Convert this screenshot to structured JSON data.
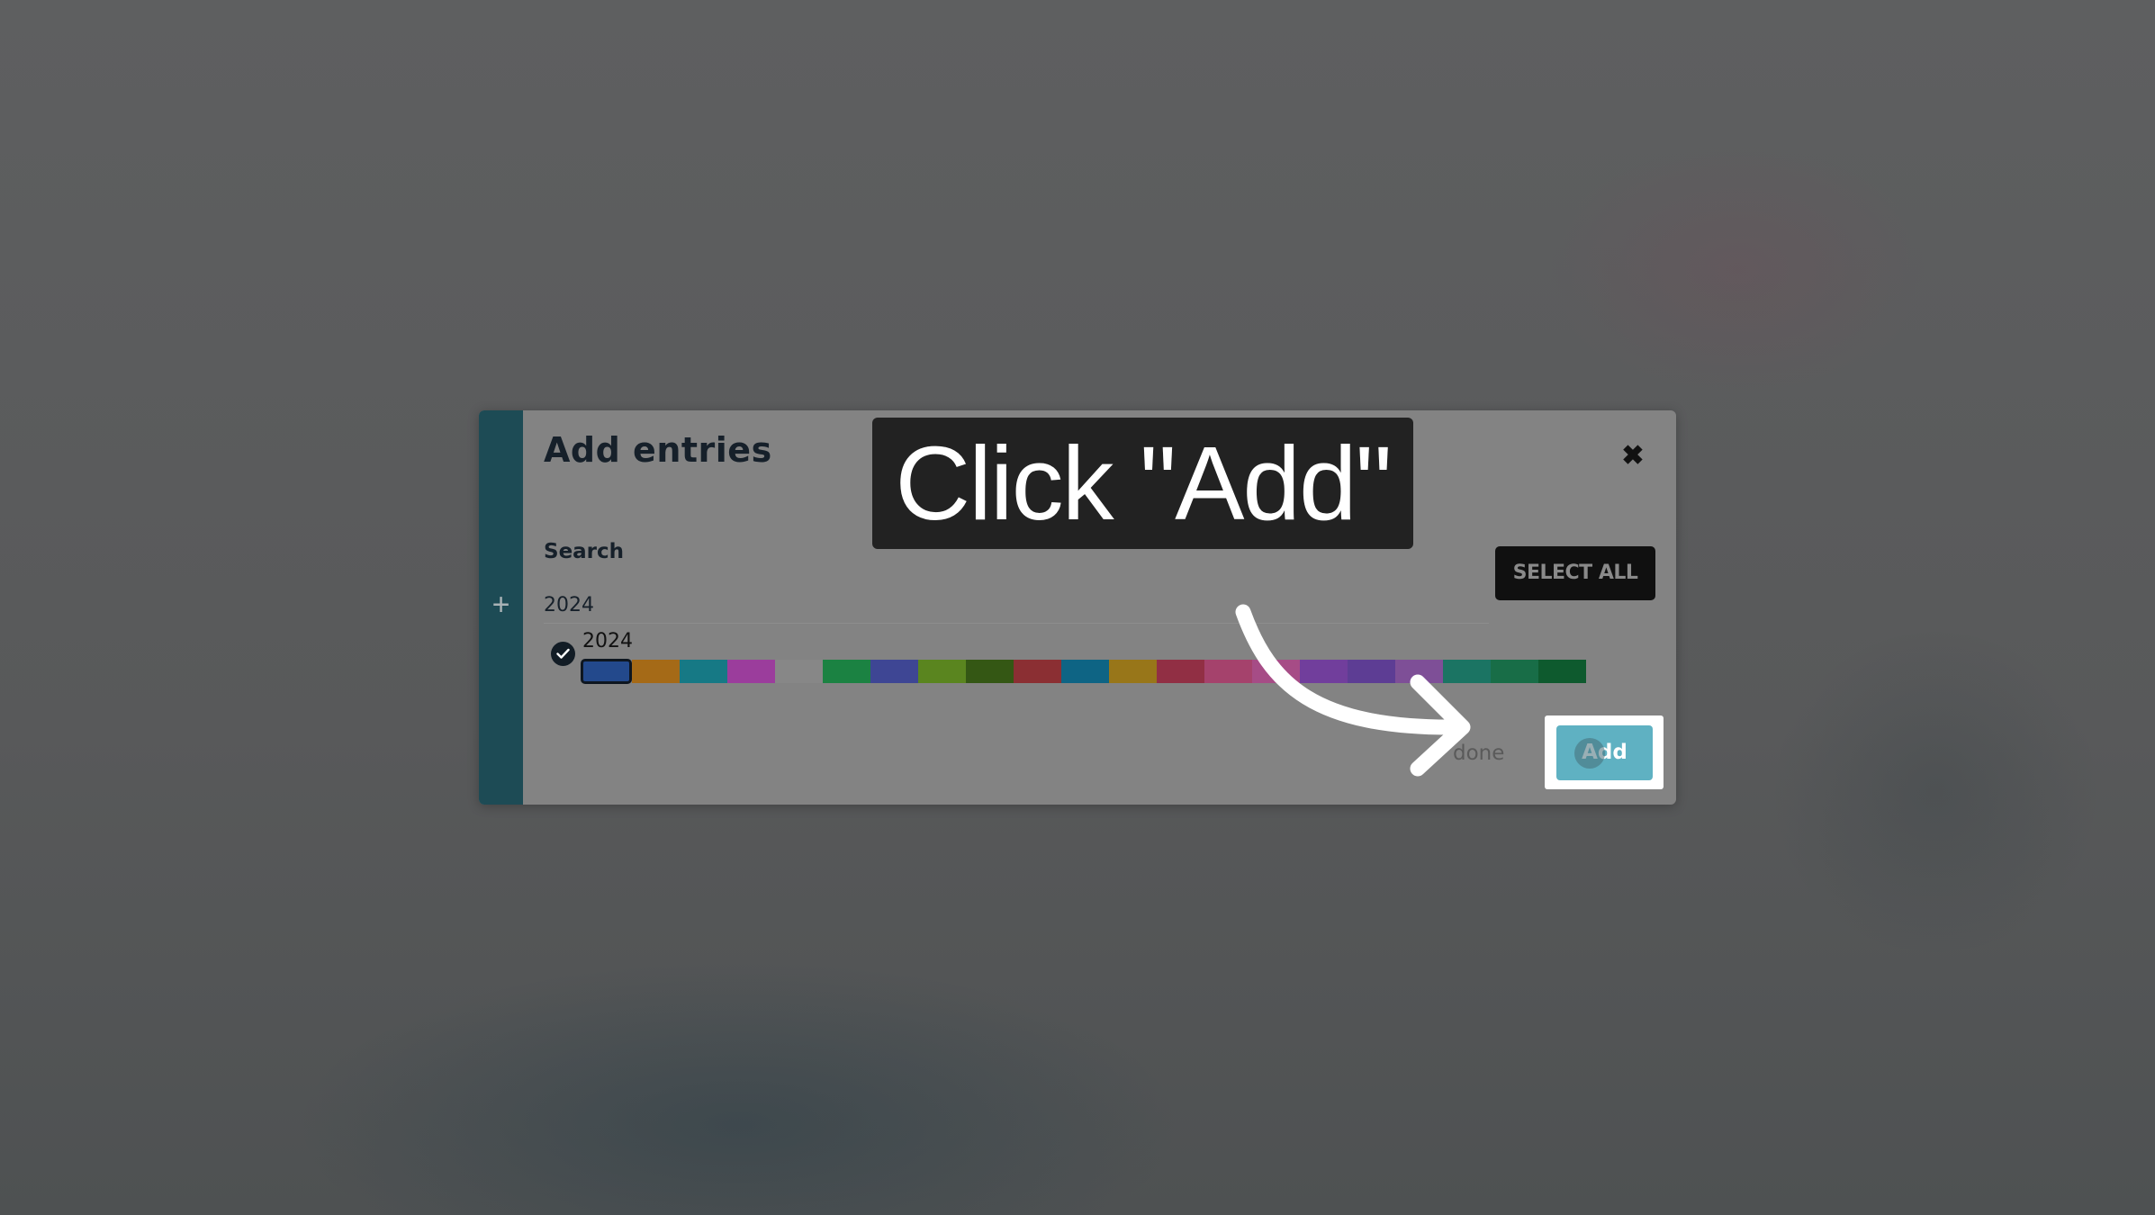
{
  "modal": {
    "title": "Add entries",
    "close_icon": "close-icon",
    "rail_icon": "plus-icon",
    "rail_symbol": "+",
    "close_symbol": "✖",
    "search": {
      "label": "Search",
      "value": "2024"
    },
    "select_all_label": "SELECT ALL",
    "entry": {
      "label": "2024",
      "checked": true,
      "check_icon": "check-circle-icon"
    },
    "color_swatches": [
      {
        "color": "#23498c",
        "selected": true
      },
      {
        "color": "#a56a17"
      },
      {
        "color": "#167985"
      },
      {
        "color": "#9b3d9c"
      },
      {
        "color": "#878787"
      },
      {
        "color": "#1b8242"
      },
      {
        "color": "#3e4694"
      },
      {
        "color": "#5a851f"
      },
      {
        "color": "#345714"
      },
      {
        "color": "#8b2f33"
      },
      {
        "color": "#0e6484"
      },
      {
        "color": "#987619"
      },
      {
        "color": "#912f44"
      },
      {
        "color": "#a5426c"
      },
      {
        "color": "#a64c86"
      },
      {
        "color": "#713e9c"
      },
      {
        "color": "#5d3d94"
      },
      {
        "color": "#7e4f97"
      },
      {
        "color": "#1b7463"
      },
      {
        "color": "#186d47"
      },
      {
        "color": "#0e5a2e"
      }
    ],
    "done_label": "done",
    "add_label": "Add"
  },
  "overlay": {
    "callout_text": "Click \"Add\"",
    "arrow_icon": "curved-arrow-icon"
  },
  "colors": {
    "backdrop": "#5b5c5d",
    "modal_bg": "#838383",
    "rail": "#1d4b55",
    "add_button": "#5fb1c2",
    "select_all_bg": "#101010",
    "callout_bg": "#222222"
  }
}
